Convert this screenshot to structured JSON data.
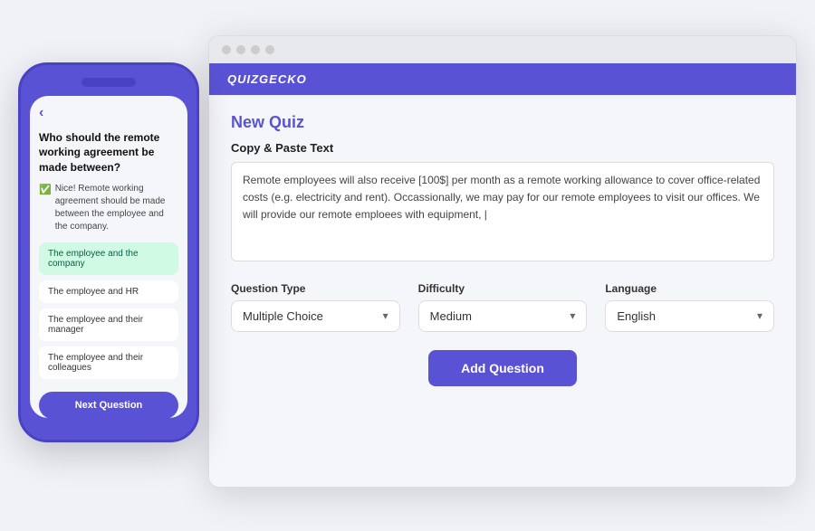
{
  "app": {
    "name": "QUIZGECKO",
    "background_color": "#5a52d5"
  },
  "browser": {
    "dots": [
      "dot1",
      "dot2",
      "dot3",
      "dot4"
    ]
  },
  "quiz": {
    "title": "New Quiz",
    "section_label": "Copy & Paste Text",
    "text_content": "Remote employees will also receive [100$] per month as a remote working allowance to cover office-related costs (e.g. electricity and rent). Occassionally, we may pay for our remote employees to visit our offices. We will provide our remote emploees with equipment, |",
    "question_type_label": "Question Type",
    "difficulty_label": "Difficulty",
    "language_label": "Language",
    "question_type_value": "Multiple Choice",
    "difficulty_value": "Medium",
    "language_value": "English",
    "add_question_label": "Add Question"
  },
  "phone": {
    "back_icon": "‹",
    "question": "Who should the remote working agreement be made between?",
    "feedback": "Nice! Remote working agreement should be made between the employee and the company.",
    "answers": [
      {
        "text": "The employee and the company",
        "correct": true
      },
      {
        "text": "The employee and HR",
        "correct": false
      },
      {
        "text": "The employee and their manager",
        "correct": false
      },
      {
        "text": "The employee and their colleagues",
        "correct": false
      }
    ],
    "next_button_label": "Next Question"
  }
}
